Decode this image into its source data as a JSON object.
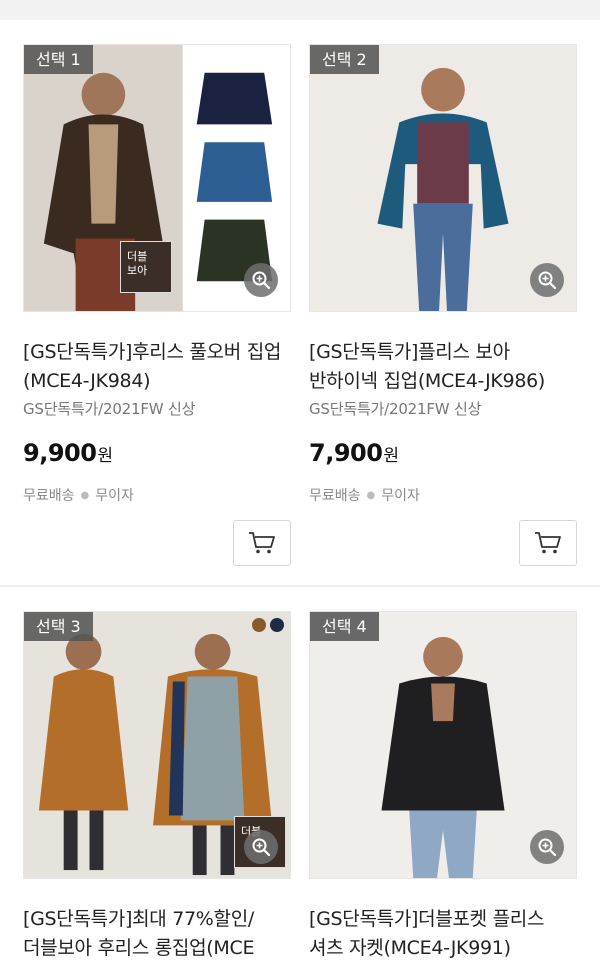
{
  "products": [
    {
      "badge": "선택 1",
      "title": "[GS단독특가]후리스 풀오버 집업(MCE4-JK984)",
      "subtitle": "GS단독특가/2021FW 신상",
      "price": "9,900",
      "currency": "원",
      "shipping": "무료배송",
      "installment": "무이자",
      "tag_label": "더블\n보아",
      "icons": [
        "zoom-icon",
        "cart-icon"
      ]
    },
    {
      "badge": "선택 2",
      "title": "[GS단독특가]플리스 보아 반하이넥 집업(MCE4-JK986)",
      "subtitle": "GS단독특가/2021FW 신상",
      "price": "7,900",
      "currency": "원",
      "shipping": "무료배송",
      "installment": "무이자",
      "icons": [
        "zoom-icon",
        "cart-icon"
      ]
    },
    {
      "badge": "선택 3",
      "title": "[GS단독특가]최대 77%할인/더블보아 후리스 롱집업(MCE",
      "tag_label": "더블",
      "swatch_colors": [
        "#8a5a2b",
        "#1f2b44"
      ],
      "icons": [
        "zoom-icon"
      ]
    },
    {
      "badge": "선택 4",
      "title": "[GS단독특가]더블포켓 플리스 셔츠 자켓(MCE4-JK991)",
      "icons": [
        "zoom-icon"
      ]
    }
  ],
  "colors": {
    "badge_bg": "#555555",
    "price": "#111111",
    "muted": "#8a8a8a",
    "divider": "#ececec"
  }
}
